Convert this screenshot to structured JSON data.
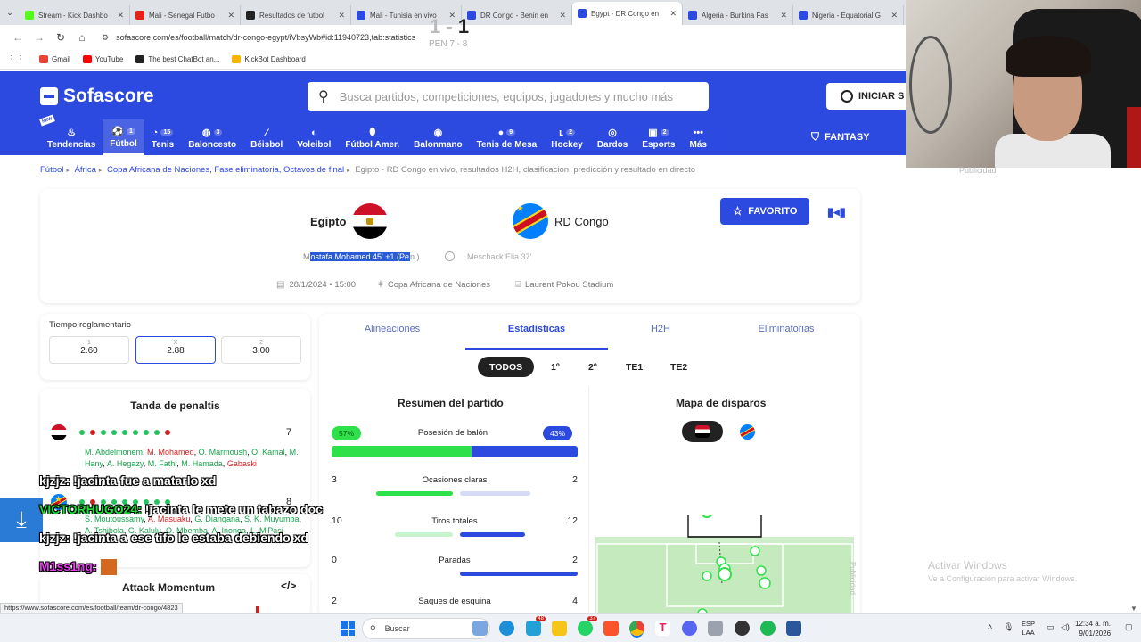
{
  "browser": {
    "tabs": [
      {
        "title": "Stream - Kick Dashbo",
        "color": "#53fc18",
        "active": false
      },
      {
        "title": "Mali - Senegal Futbo",
        "color": "#e62117",
        "active": false
      },
      {
        "title": "Resultados de futbol",
        "color": "#222222",
        "active": false
      },
      {
        "title": "Mali - Tunisia en vivo",
        "color": "#2c49e0",
        "active": false
      },
      {
        "title": "DR Congo - Benin en",
        "color": "#2c49e0",
        "active": false
      },
      {
        "title": "Egypt - DR Congo en",
        "color": "#2c49e0",
        "active": true
      },
      {
        "title": "Algeria - Burkina Fas",
        "color": "#2c49e0",
        "active": false
      },
      {
        "title": "Nigeria - Equatorial G",
        "color": "#2c49e0",
        "active": false
      }
    ],
    "url": "sofascore.com/es/football/match/dr-congo-egypt/iVbsyWb#id:11940723,tab:statistics",
    "bookmarks": [
      {
        "label": "Gmail",
        "color": "#ea4335"
      },
      {
        "label": "YouTube",
        "color": "#ff0000"
      },
      {
        "label": "The best ChatBot an...",
        "color": "#222222"
      },
      {
        "label": "KickBot Dashboard",
        "color": "#f5b400"
      }
    ],
    "status_url": "https://www.sofascore.com/es/football/team/dr-congo/4823"
  },
  "header": {
    "logo": "Sofascore",
    "search_placeholder": "Busca partidos, competiciones, equipos, jugadores y mucho más",
    "login_label": "INICIAR S",
    "fantasy_label": "FANTASY",
    "new_badge": "NEW",
    "sports": [
      {
        "label": "Tendencias",
        "icon": "flame-icon",
        "count": ""
      },
      {
        "label": "Fútbol",
        "icon": "soccer-icon",
        "count": "1"
      },
      {
        "label": "Tenis",
        "icon": "tennis-icon",
        "count": "15"
      },
      {
        "label": "Baloncesto",
        "icon": "basketball-icon",
        "count": "3"
      },
      {
        "label": "Béisbol",
        "icon": "baseball-icon",
        "count": ""
      },
      {
        "label": "Voleibol",
        "icon": "volleyball-icon",
        "count": ""
      },
      {
        "label": "Fútbol Amer.",
        "icon": "football-icon",
        "count": ""
      },
      {
        "label": "Balonmano",
        "icon": "handball-icon",
        "count": ""
      },
      {
        "label": "Tenis de Mesa",
        "icon": "table-tennis-icon",
        "count": "9"
      },
      {
        "label": "Hockey",
        "icon": "hockey-icon",
        "count": "2"
      },
      {
        "label": "Dardos",
        "icon": "darts-icon",
        "count": ""
      },
      {
        "label": "Esports",
        "icon": "esports-icon",
        "count": "2"
      },
      {
        "label": "Más",
        "icon": "more-icon",
        "count": ""
      }
    ]
  },
  "breadcrumb": {
    "items": [
      "Fútbol",
      "África",
      "Copa Africana de Naciones, Fase eliminatoria, Octavos de final"
    ],
    "current": "Egipto - RD Congo en vivo, resultados H2H, clasificación, predicción y resultado en directo"
  },
  "match": {
    "home": "Egipto",
    "away": "RD Congo",
    "score_home": "1",
    "score_sep": "-",
    "score_away": "1",
    "penalties": "PEN 7 - 8",
    "home_scorer_prefix": "M",
    "home_scorer_selected": "ostafa Mohamed 45' +1 (Pe",
    "home_scorer_suffix": "n.)",
    "away_scorer": "Meschack Elia 37'",
    "date": "28/1/2024 • 15:00",
    "competition": "Copa Africana de Naciones",
    "stadium": "Laurent Pokou Stadium",
    "favorite_label": "FAVORITO"
  },
  "odds": {
    "label": "Tiempo reglamentario",
    "items": [
      {
        "key": "1",
        "value": "2.60"
      },
      {
        "key": "X",
        "value": "2.88"
      },
      {
        "key": "2",
        "value": "3.00"
      }
    ]
  },
  "stats": {
    "tabs": [
      "Alineaciones",
      "Estadísticas",
      "H2H",
      "Eliminatorias"
    ],
    "periods": [
      "TODOS",
      "1º",
      "2º",
      "TE1",
      "TE2"
    ],
    "summary_title": "Resumen del partido",
    "shotmap_title": "Mapa de disparos",
    "possession": {
      "label": "Posesión de balón",
      "home": "57%",
      "away": "43%",
      "home_fraction": 0.57
    },
    "rows": [
      {
        "label": "Ocasiones claras",
        "home": "3",
        "away": "2",
        "home_frac": 0.8,
        "away_frac": 0.6
      },
      {
        "label": "Tiros totales",
        "home": "10",
        "away": "12",
        "home_frac": 0.6,
        "away_frac": 0.55
      },
      {
        "label": "Paradas",
        "home": "0",
        "away": "2",
        "home_frac": 0,
        "away_frac": 1.0
      },
      {
        "label": "Saques de esquina",
        "home": "2",
        "away": "4",
        "home_frac": 0,
        "away_frac": 0
      }
    ]
  },
  "penalties": {
    "title": "Tanda de penaltis",
    "home_dots": [
      "g",
      "r",
      "g",
      "g",
      "g",
      "g",
      "g",
      "g",
      "r"
    ],
    "home_total": "7",
    "away_dots": [
      "g",
      "r",
      "g",
      "g",
      "g",
      "g",
      "g",
      "g",
      "g"
    ],
    "away_total": "8",
    "home_takers": [
      {
        "name": "M. Abdelmonem",
        "ok": true
      },
      {
        "name": "M. Mohamed",
        "ok": false
      },
      {
        "name": "O. Marmoush",
        "ok": true
      },
      {
        "name": "O. Kamal",
        "ok": true
      },
      {
        "name": "M. Hany",
        "ok": true
      },
      {
        "name": "A. Hegazy",
        "ok": true
      },
      {
        "name": "M. Fathi",
        "ok": true
      },
      {
        "name": "M. Hamada",
        "ok": true
      },
      {
        "name": "Gabaski",
        "ok": false
      }
    ],
    "away_takers": [
      {
        "name": "S. Moutoussamy",
        "ok": true
      },
      {
        "name": "A. Masuaku",
        "ok": false
      },
      {
        "name": "G. Diangana",
        "ok": true
      },
      {
        "name": "S. K. Muyumba",
        "ok": true
      },
      {
        "name": "A. Tshibola",
        "ok": true
      },
      {
        "name": "G. Kalulu",
        "ok": true
      },
      {
        "name": "O. Mbemba",
        "ok": true
      },
      {
        "name": "A. Inonga",
        "ok": true
      },
      {
        "name": "L. M'Pasi",
        "ok": true
      }
    ]
  },
  "attack": {
    "title": "Attack Momentum",
    "code_icon": "</>"
  },
  "side": {
    "ad": "Publicidad",
    "activate_title": "Activar Windows",
    "activate_sub": "Ve a Configuración para activar Windows."
  },
  "chat": [
    {
      "user": "kjzjz:",
      "msg": " !jacinta fue a matarlo xd",
      "color": "white"
    },
    {
      "user": "VICTORHUGO24:",
      "msg": " !jacinta le mete un tabazo doc",
      "color": "green"
    },
    {
      "user": "kjzjz:",
      "msg": " !jacinta a ese tifo le estaba debiendo xd",
      "color": "white"
    },
    {
      "user": "M1ss1ng:",
      "msg": "",
      "color": "magenta"
    }
  ],
  "taskbar": {
    "search": "Buscar",
    "lang": "ESP",
    "lang2": "LAA",
    "time": "12:34 a. m.",
    "date": "9/01/2026"
  }
}
